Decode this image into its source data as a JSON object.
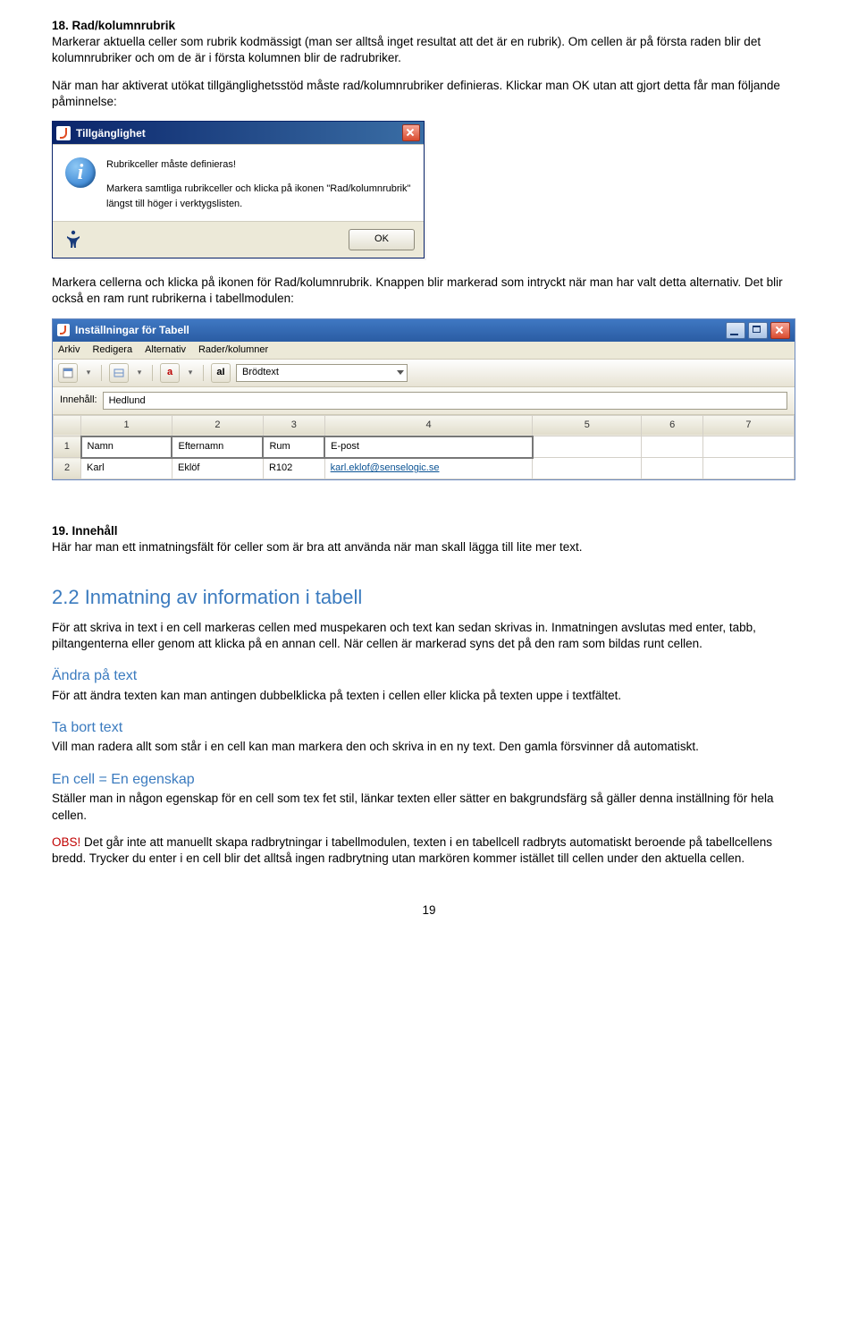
{
  "section18": {
    "heading": "18. Rad/kolumnrubrik",
    "p1": "Markerar aktuella celler som rubrik kodmässigt (man ser alltså inget resultat att det är en rubrik). Om cellen är på första raden blir det kolumnrubriker och om de är i första kolumnen blir de radrubriker.",
    "p2": "När man har aktiverat utökat tillgänglighetsstöd måste rad/kolumnrubriker definieras. Klickar man OK utan att gjort detta får man följande påminnelse:"
  },
  "dialog": {
    "title": "Tillgänglighet",
    "line1": "Rubrikceller måste definieras!",
    "line2": "Markera samtliga rubrikceller och klicka på ikonen \"Rad/kolumnrubrik\" längst till höger i verktygslisten.",
    "ok": "OK"
  },
  "afterDialog": {
    "p": "Markera cellerna och klicka på ikonen för Rad/kolumnrubrik. Knappen blir markerad som intryckt när man har valt detta alternativ. Det blir också en ram runt rubrikerna i tabellmodulen:"
  },
  "win": {
    "title": "Inställningar för Tabell",
    "menus": [
      "Arkiv",
      "Redigera",
      "Alternativ",
      "Rader/kolumner"
    ],
    "combo": "Brödtext",
    "content_label": "Innehåll:",
    "content_value": "Hedlund",
    "cols": [
      "1",
      "2",
      "3",
      "4",
      "5",
      "6",
      "7"
    ],
    "row1": {
      "id": "1",
      "cells": [
        "Namn",
        "Efternamn",
        "Rum",
        "E-post",
        "",
        "",
        ""
      ]
    },
    "row2": {
      "id": "2",
      "cells": [
        "Karl",
        "Eklöf",
        "R102",
        "karl.eklof@senselogic.se",
        "",
        "",
        ""
      ]
    }
  },
  "section19": {
    "heading": "19. Innehåll",
    "p": "Här har man ett inmatningsfält för celler som är bra att använda när man skall lägga till lite mer text."
  },
  "sec22": {
    "heading": "2.2 Inmatning av information i tabell",
    "p1": "För att skriva in text i en cell markeras cellen med muspekaren och text kan sedan skrivas in. Inmatningen avslutas med enter, tabb, piltangenterna eller genom att klicka på en annan cell. När cellen är markerad syns det på den ram som bildas runt cellen.",
    "h_change": "Ändra på text",
    "p_change": "För att ändra texten kan man antingen dubbelklicka på texten i cellen eller klicka på texten uppe i textfältet.",
    "h_remove": "Ta bort text",
    "p_remove": "Vill man radera allt som står i en cell kan man markera den och skriva in en ny text. Den gamla försvinner då automatiskt.",
    "h_cell": "En cell = En egenskap",
    "p_cell": "Ställer man in någon egenskap för en cell som tex fet stil, länkar texten eller sätter en bakgrundsfärg så gäller denna inställning för hela cellen.",
    "obs_label": "OBS!",
    "obs_text": " Det går inte att manuellt skapa radbrytningar i tabellmodulen, texten i en tabellcell radbryts automatiskt beroende på tabellcellens bredd. Trycker du enter i en cell blir det alltså ingen radbrytning utan markören kommer istället till cellen under den aktuella cellen."
  },
  "pageNumber": "19",
  "icons": {
    "a_icon_text": "a",
    "al_icon_text": "aI"
  }
}
